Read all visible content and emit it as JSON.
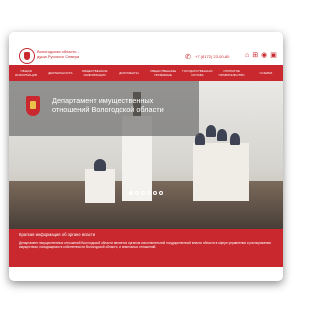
{
  "header": {
    "brand_line1": "Вологодская область -",
    "brand_line2": "душа Русского Севера",
    "phone": "+7 (8172) 23-00-80"
  },
  "header_icons": [
    "home-icon",
    "sitemap-icon",
    "eye-icon",
    "print-icon"
  ],
  "nav": {
    "items": [
      "ОБЩАЯ ИНФОРМАЦИЯ",
      "ДЕЯТЕЛЬНОСТЬ",
      "ОБЩЕСТВЕННОЕ ИНФОРМАЦИЯ",
      "ДОКУМЕНТЫ",
      "ОБЩЕСТВЕННЫЕ ПРИЁМНЫЕ",
      "ГОСУДАРСТВЕННАЯ СЛУЖБА",
      "ОТКРЫТОЕ ПРАВИТЕЛЬСТВО",
      "ССЫЛКИ"
    ]
  },
  "hero": {
    "department_line1": "Департамент имущественных",
    "department_line2": "отношений Вологодской области"
  },
  "info": {
    "title": "Краткая информация об органе власти",
    "text": "Департамент имущественных отношений Вологодской области является органом исполнительной государственной власти области в сфере управления и распоряжения имуществом, находящимся в собственности Вологодской области, и земельных отношений."
  },
  "colors": {
    "accent": "#c8282e",
    "overlay": "#5e5e5e",
    "background": "#ffffff"
  }
}
